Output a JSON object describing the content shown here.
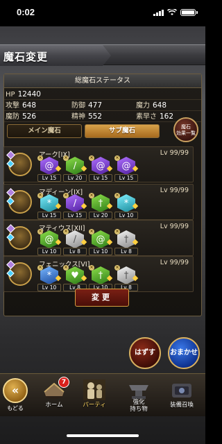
{
  "status_bar": {
    "time": "0:02"
  },
  "title": "魔石変更",
  "panel": {
    "header": "総魔石ステータス",
    "stats": {
      "hp_label": "HP",
      "hp": "12440",
      "atk_label": "攻撃",
      "atk": "648",
      "def_label": "防御",
      "def": "477",
      "mag_label": "魔力",
      "mag": "648",
      "mdef_label": "魔防",
      "mdef": "526",
      "spr_label": "精神",
      "spr": "552",
      "spd_label": "素早さ",
      "spd": "162"
    },
    "tabs": {
      "main": "メイン魔石",
      "sub": "サブ魔石"
    },
    "effects_button": "魔石\n効果一覧"
  },
  "rows": [
    {
      "name": "アーク[IX]",
      "lv": "Lv 99/99",
      "stones": [
        {
          "color": "purple",
          "icon": "spiral",
          "lv": "Lv 15"
        },
        {
          "color": "green",
          "icon": "wand",
          "lv": "Lv 20"
        },
        {
          "color": "purple",
          "icon": "spiral",
          "lv": "Lv 15"
        },
        {
          "color": "purple",
          "icon": "spiral",
          "lv": "Lv 15"
        }
      ]
    },
    {
      "name": "マディーン[IX]",
      "lv": "Lv 99/99",
      "stones": [
        {
          "color": "cyan",
          "icon": "snowflake",
          "lv": "Lv 15"
        },
        {
          "color": "purple",
          "icon": "wand",
          "lv": "Lv 15"
        },
        {
          "color": "green",
          "icon": "sword",
          "lv": "Lv 20"
        },
        {
          "color": "cyan",
          "icon": "snowflake",
          "lv": "Lv 10"
        }
      ]
    },
    {
      "name": "マティウス[XII]",
      "lv": "Lv 99/99",
      "stones": [
        {
          "color": "green",
          "icon": "spiral",
          "lv": "Lv 10"
        },
        {
          "color": "white",
          "icon": "wand",
          "lv": "Lv 8"
        },
        {
          "color": "green",
          "icon": "spiral",
          "lv": "Lv 10"
        },
        {
          "color": "white",
          "icon": "sword",
          "lv": "Lv 8"
        }
      ]
    },
    {
      "name": "フェニックス[VI]",
      "lv": "Lv 99/99",
      "stones": [
        {
          "color": "blue",
          "icon": "snowflake",
          "lv": "Lv 10"
        },
        {
          "color": "green",
          "icon": "heart",
          "lv": "Lv 8"
        },
        {
          "color": "green",
          "icon": "sword",
          "lv": "Lv 10"
        },
        {
          "color": "white",
          "icon": "sword",
          "lv": "Lv 8"
        }
      ]
    }
  ],
  "change_button": "変更",
  "remove_button": "はずす",
  "auto_button": "おまかせ",
  "nav": {
    "back": "もどる",
    "home": "ホーム",
    "home_badge": "7",
    "party": "パーティ",
    "items": "強化\n持ち物",
    "summon": "装備召喚"
  }
}
